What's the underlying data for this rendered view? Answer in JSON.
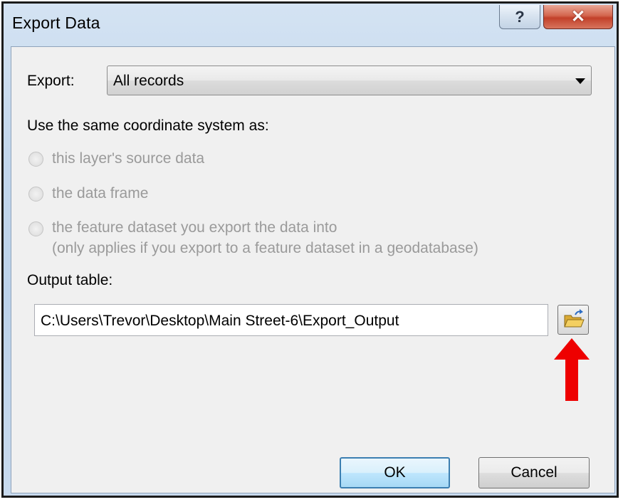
{
  "window": {
    "title": "Export Data",
    "help_label": "?",
    "close_label": "✕"
  },
  "export": {
    "label": "Export:",
    "selected": "All records"
  },
  "coordinate_system": {
    "heading": "Use the same coordinate system as:",
    "options": [
      {
        "label": "this layer's source data",
        "enabled": false,
        "checked": false
      },
      {
        "label": "the data frame",
        "enabled": false,
        "checked": false
      },
      {
        "label": "the feature dataset you export the data into",
        "note": "(only applies if you export to a feature dataset in a geodatabase)",
        "enabled": false,
        "checked": false
      }
    ]
  },
  "output": {
    "label": "Output table:",
    "path": "C:\\Users\\Trevor\\Desktop\\Main Street-6\\Export_Output",
    "browse_icon": "open-folder-icon"
  },
  "annotation": {
    "arrow_icon": "red-up-arrow-icon",
    "color": "#ee0000"
  },
  "buttons": {
    "ok": "OK",
    "cancel": "Cancel"
  }
}
